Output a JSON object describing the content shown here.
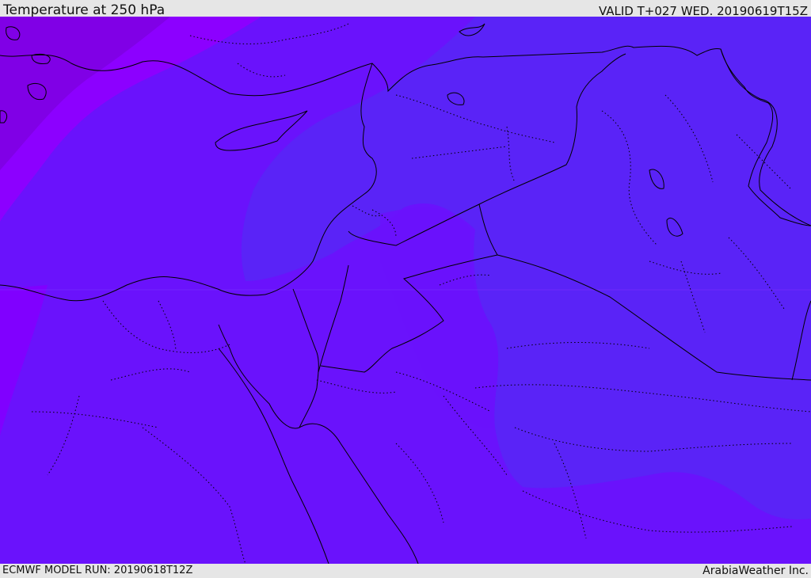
{
  "header": {
    "title": "Temperature at 250 hPa",
    "valid": "VALID T+027 WED. 20190619T15Z"
  },
  "footer": {
    "model_run": "ECMWF MODEL RUN: 20190618T12Z",
    "credit": "ArabiaWeather Inc."
  },
  "colors": {
    "shade_warm": "#8000ec",
    "shade_purple": "#8c00ff",
    "shade_mid": "#6a12fc",
    "shade_cool": "#5924f8",
    "borders": "#000000"
  }
}
